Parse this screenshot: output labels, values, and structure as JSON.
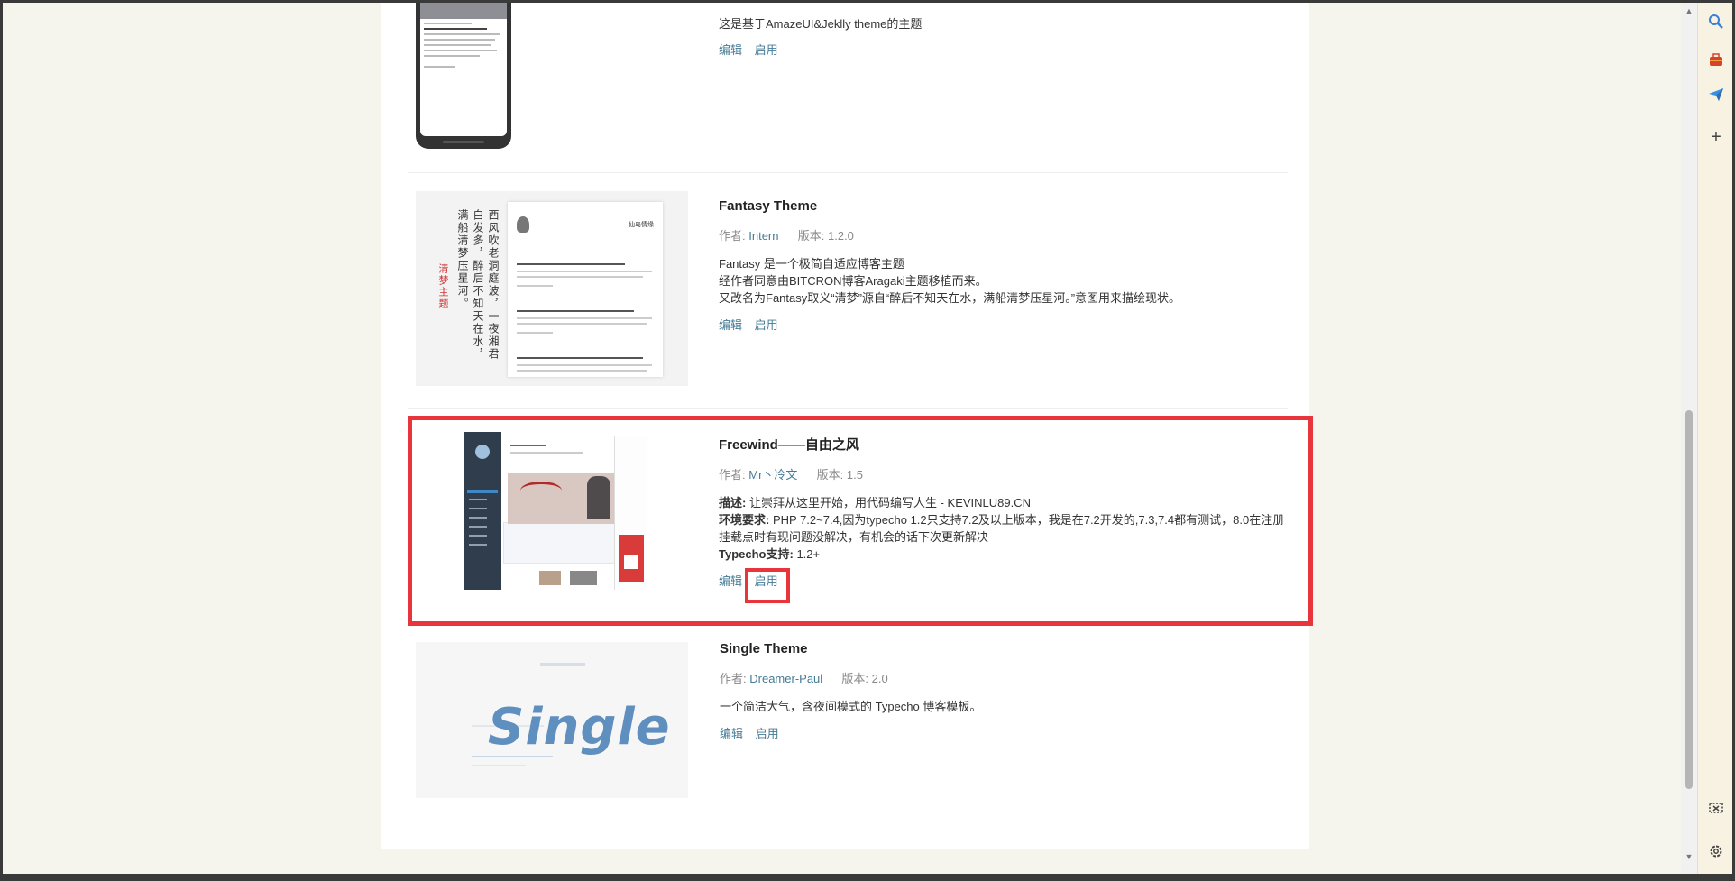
{
  "themes": [
    {
      "description": "这是基于AmazeUI&Jeklly theme的主题",
      "edit_label": "编辑",
      "enable_label": "启用"
    },
    {
      "name": "Fantasy Theme",
      "author_label": "作者:",
      "author": "Intern",
      "version_label": "版本:",
      "version": "1.2.0",
      "description_lines": [
        "Fantasy 是一个极简自适应博客主题",
        "经作者同意由BITCRON博客Aragaki主题移植而来。",
        "又改名为Fantasy取义“清梦”源自“醉后不知天在水，满船清梦压星河。”意图用来描绘现状。"
      ],
      "edit_label": "编辑",
      "enable_label": "启用",
      "thumb_title": "仙岛情缘",
      "thumb_poem": "西风吹老洞庭波，一夜湘君白发多，醉后不知天在水，满船清梦压星河。",
      "thumb_mark": "清梦主题"
    },
    {
      "name": "Freewind——自由之风",
      "author_label": "作者:",
      "author": "Mr丶冷文",
      "version_label": "版本:",
      "version": "1.5",
      "desc_label": "描述:",
      "desc_text": "让崇拜从这里开始，用代码编写人生 - KEVINLU89.CN",
      "env_label": "环境要求:",
      "env_text": "PHP 7.2~7.4,因为typecho 1.2只支持7.2及以上版本，我是在7.2开发的,7.3,7.4都有测试，8.0在注册挂载点时有现问题没解决，有机会的话下次更新解决",
      "typecho_label": "Typecho支持:",
      "typecho_text": "1.2+",
      "edit_label": "编辑",
      "enable_label": "启用"
    },
    {
      "name": "Single Theme",
      "author_label": "作者:",
      "author": "Dreamer-Paul",
      "version_label": "版本:",
      "version": "2.0",
      "description": "一个简洁大气，含夜间模式的 Typecho 博客模板。",
      "edit_label": "编辑",
      "enable_label": "启用",
      "thumb_logo": "Single"
    }
  ],
  "colors": {
    "link": "#467b96",
    "highlight": "#e8353b",
    "background": "#f5f5ed"
  },
  "toolbar": {
    "icons": [
      "search-icon",
      "toolbox-icon",
      "send-icon",
      "add-icon",
      "screenshot-icon",
      "settings-icon"
    ]
  }
}
